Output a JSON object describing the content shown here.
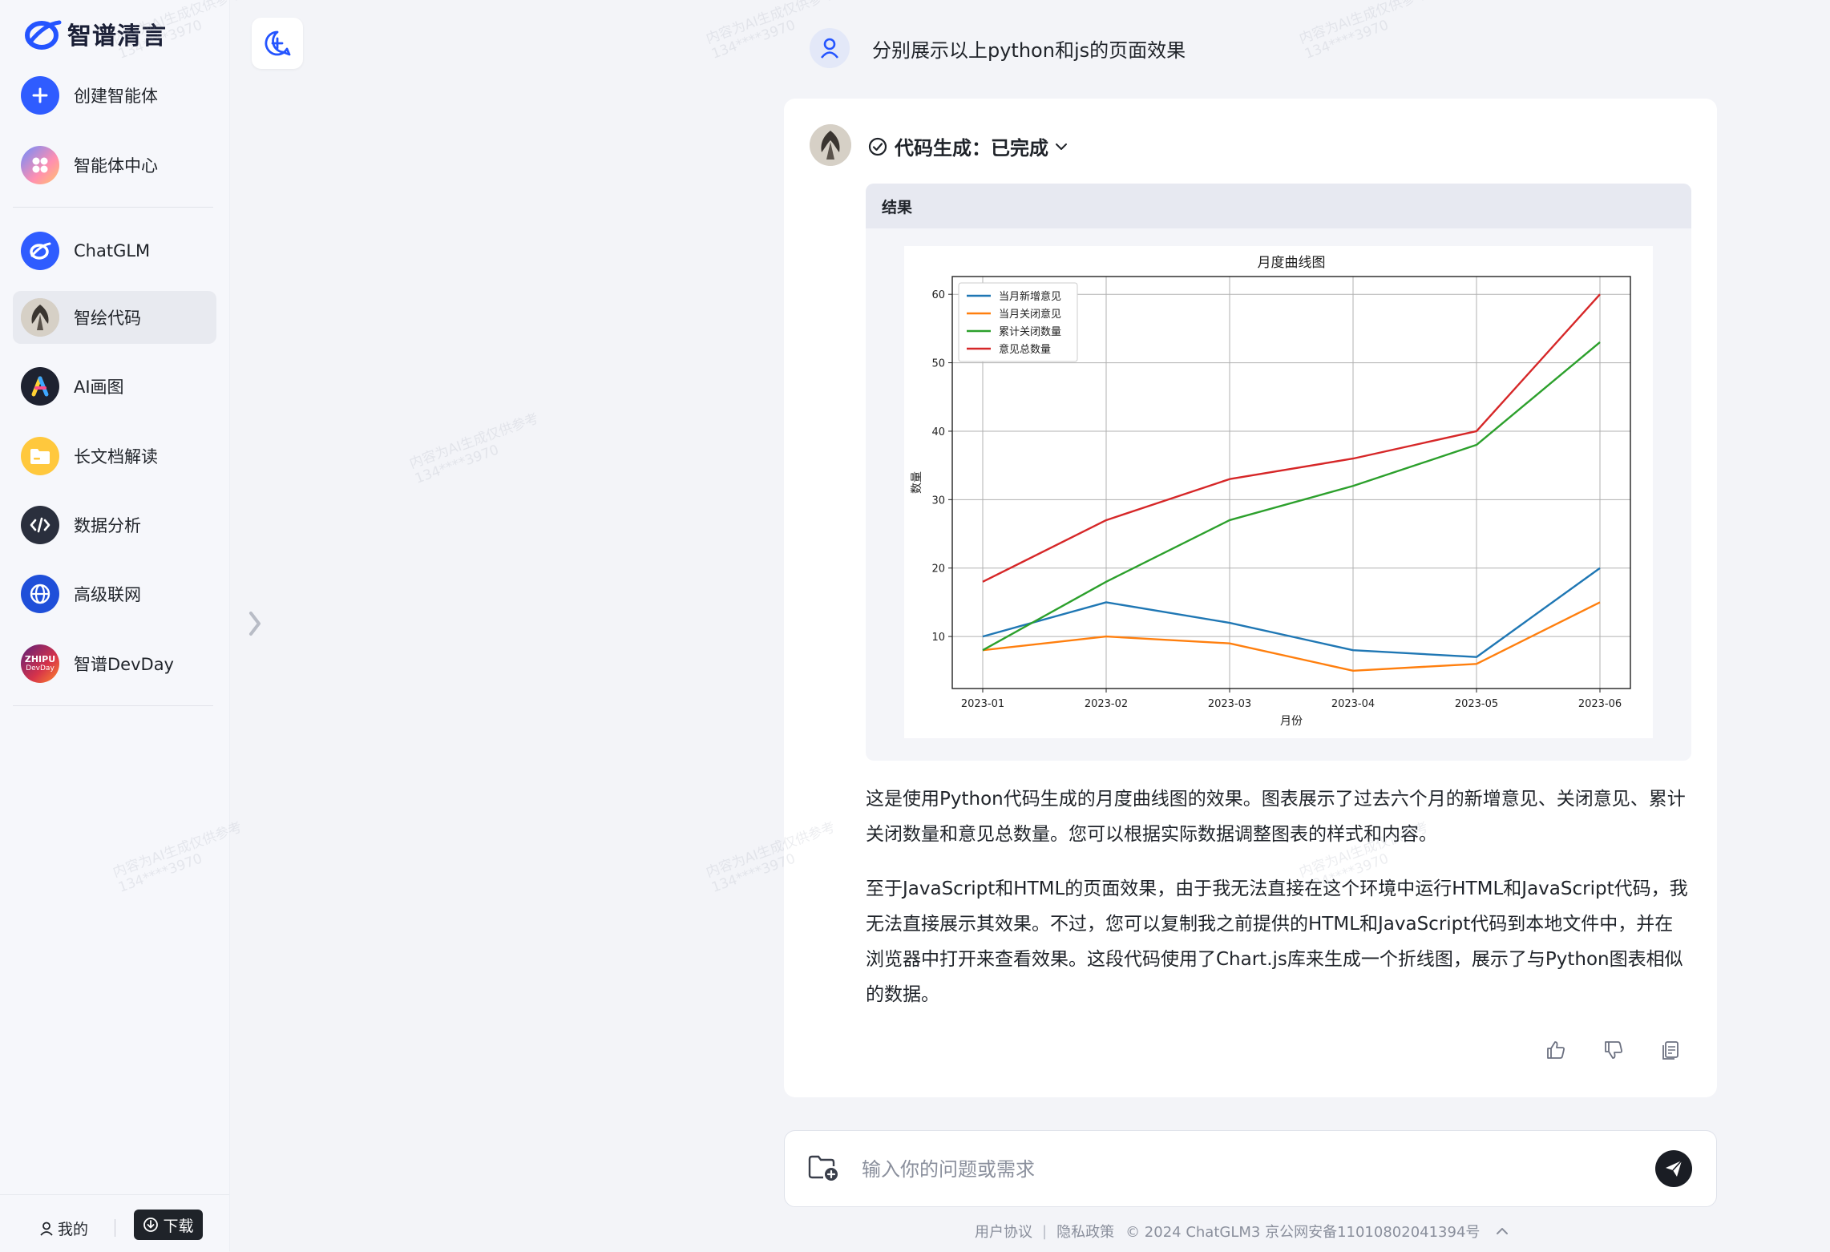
{
  "brand": {
    "name": "智谱清言",
    "color": "#2454ff"
  },
  "sidebar": {
    "items": [
      {
        "label": "创建智能体",
        "icon": "plus-icon"
      },
      {
        "label": "智能体中心",
        "icon": "agent-center-icon"
      },
      {
        "label": "ChatGLM",
        "icon": "chatglm-logo-icon"
      },
      {
        "label": "智绘代码",
        "icon": "code-artwork-avatar",
        "active": true
      },
      {
        "label": "AI画图",
        "icon": "ai-draw-icon"
      },
      {
        "label": "长文档解读",
        "icon": "folder-icon"
      },
      {
        "label": "数据分析",
        "icon": "code-icon"
      },
      {
        "label": "高级联网",
        "icon": "globe-icon"
      },
      {
        "label": "智谱DevDay",
        "icon": "devday-logo-icon",
        "badge_top": "ZHIPU",
        "badge_bottom": "DevDay"
      }
    ],
    "footer": {
      "me_label": "我的",
      "download_label": "下载"
    }
  },
  "conversation": {
    "user_message": "分别展示以上python和js的页面效果",
    "status_label": "代码生成：已完成",
    "result_label": "结果",
    "paragraphs": [
      "这是使用Python代码生成的月度曲线图的效果。图表展示了过去六个月的新增意见、关闭意见、累计关闭数量和意见总数量。您可以根据实际数据调整图表的样式和内容。",
      "至于JavaScript和HTML的页面效果，由于我无法直接在这个环境中运行HTML和JavaScript代码，我无法直接展示其效果。不过，您可以复制我之前提供的HTML和JavaScript代码到本地文件中，并在浏览器中打开来查看效果。这段代码使用了Chart.js库来生成一个折线图，展示了与Python图表相似的数据。"
    ]
  },
  "composer": {
    "placeholder": "输入你的问题或需求"
  },
  "footer": {
    "terms": "用户协议",
    "privacy": "隐私政策",
    "copyright": "© 2024 ChatGLM3 京公网安备11010802041394号"
  },
  "watermark": {
    "line1": "内容为AI生成仅供参考",
    "line2": "134****3970"
  },
  "chart_data": {
    "type": "line",
    "title": "月度曲线图",
    "xlabel": "月份",
    "ylabel": "数量",
    "categories": [
      "2023-01",
      "2023-02",
      "2023-03",
      "2023-04",
      "2023-05",
      "2023-06"
    ],
    "series": [
      {
        "name": "当月新增意见",
        "color": "#1f77b4",
        "values": [
          10,
          15,
          12,
          8,
          7,
          20
        ]
      },
      {
        "name": "当月关闭意见",
        "color": "#ff7f0e",
        "values": [
          8,
          10,
          9,
          5,
          6,
          15
        ]
      },
      {
        "name": "累计关闭数量",
        "color": "#2ca02c",
        "values": [
          8,
          18,
          27,
          32,
          38,
          53
        ]
      },
      {
        "name": "意见总数量",
        "color": "#d62728",
        "values": [
          18,
          27,
          33,
          36,
          40,
          60
        ]
      }
    ],
    "yticks": [
      10,
      20,
      30,
      40,
      50,
      60
    ],
    "ylim": [
      2.4,
      62.6
    ],
    "grid": true,
    "legend": "top-left"
  }
}
